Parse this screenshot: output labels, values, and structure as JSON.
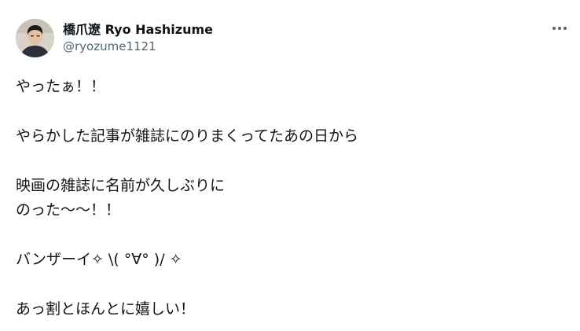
{
  "author": {
    "display_name": "橋爪遼 Ryo Hashizume",
    "handle": "@ryozume1121"
  },
  "more_icon": "more-horizontal-icon",
  "tweet_lines": [
    "やったぁ！！",
    "やらかした記事が雑誌にのりまくってたあの日から",
    "映画の雑誌に名前が久しぶりに",
    "のった～～！！",
    "バンザーイ✧ \\( °∀° )/ ✧",
    "あっ割とほんとに嬉しい！"
  ]
}
